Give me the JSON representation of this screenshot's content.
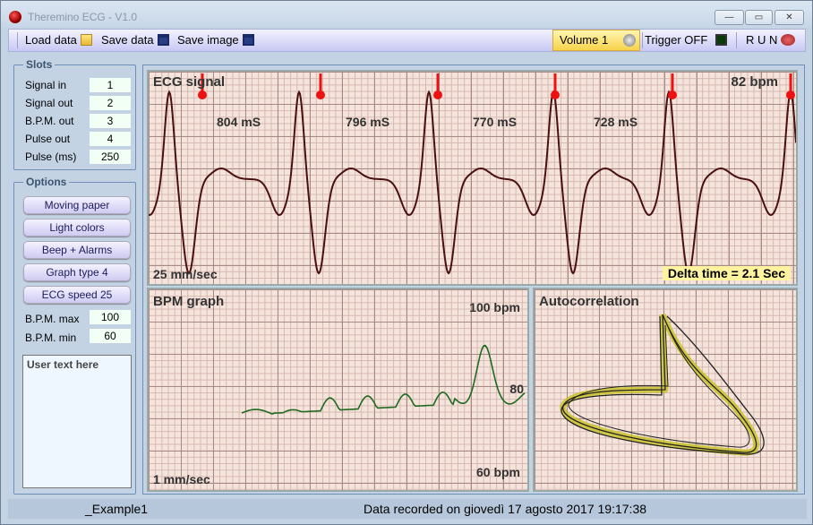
{
  "window": {
    "title": "Theremino ECG - V1.0",
    "minimize": "—",
    "maximize": "▭",
    "close": "✕"
  },
  "toolbar": {
    "load": "Load data",
    "save": "Save data",
    "save_image": "Save image",
    "volume": "Volume 1",
    "trigger": "Trigger OFF",
    "run": "R U N"
  },
  "slots": {
    "title": "Slots",
    "items": [
      {
        "label": "Signal in",
        "value": "1"
      },
      {
        "label": "Signal out",
        "value": "2"
      },
      {
        "label": "B.P.M. out",
        "value": "3"
      },
      {
        "label": "Pulse out",
        "value": "4"
      },
      {
        "label": "Pulse (ms)",
        "value": "250"
      }
    ]
  },
  "options": {
    "title": "Options",
    "buttons": [
      "Moving paper",
      "Light colors",
      "Beep + Alarms",
      "Graph type 4",
      "ECG speed 25"
    ],
    "bpm_max_label": "B.P.M. max",
    "bpm_max": "100",
    "bpm_min_label": "B.P.M. min",
    "bpm_min": "60",
    "user_text": "User text here"
  },
  "ecg": {
    "title": "ECG signal",
    "bpm": "82 bpm",
    "speed": "25 mm/sec",
    "delta": "Delta time = 2.1 Sec",
    "intervals": [
      "804 mS",
      "796 mS",
      "770 mS",
      "728 mS"
    ],
    "trace_color": "#4a0f0f",
    "marker_color": "#ee1111"
  },
  "bpm_graph": {
    "title": "BPM graph",
    "max": "100 bpm",
    "min": "60 bpm",
    "current": "80",
    "speed": "1 mm/sec",
    "trace_color": "#1f6a1f"
  },
  "autocorr": {
    "title": "Autocorrelation"
  },
  "status": {
    "file": "_Example1",
    "recorded": "Data recorded on giovedì 17 agosto 2017 19:17:38"
  }
}
